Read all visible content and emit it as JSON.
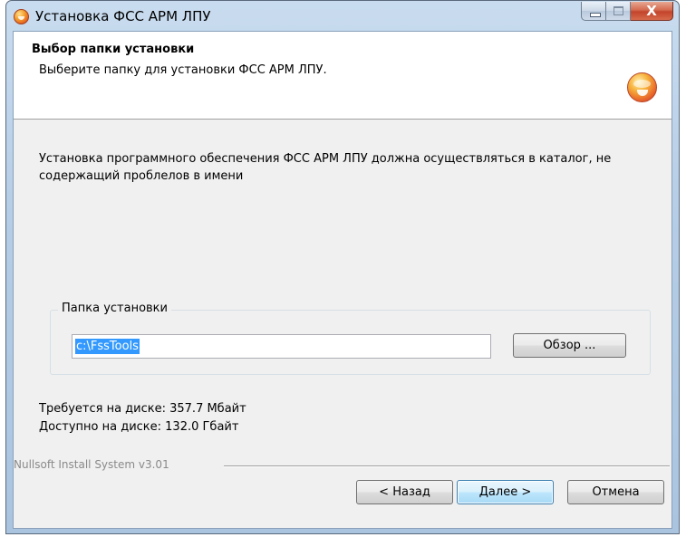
{
  "window": {
    "title": "Установка ФСС АРМ ЛПУ",
    "close_glyph": "X"
  },
  "header": {
    "title": "Выбор папки установки",
    "subtitle": "Выберите папку для установки ФСС АРМ ЛПУ."
  },
  "body": {
    "description": "Установка программного обеспечения ФСС АРМ ЛПУ должна осуществляться в каталог, не содержащий проблелов в имени"
  },
  "folder_group": {
    "legend": "Папка установки",
    "path_value": "c:\\FssTools",
    "browse_label": "Обзор ..."
  },
  "disk": {
    "required": "Требуется на диске: 357.7 Мбайт",
    "available": "Доступно на диске: 132.0 Гбайт"
  },
  "footer": {
    "branding": "Nullsoft Install System v3.01",
    "back_label": "< Назад",
    "next_label": "Далее >",
    "cancel_label": "Отмена"
  }
}
